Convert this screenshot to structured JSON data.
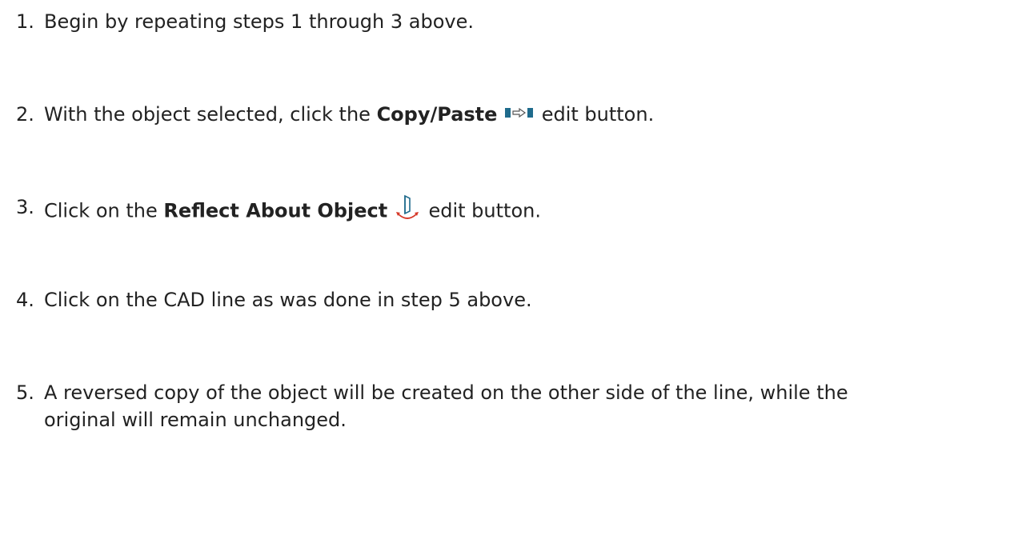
{
  "steps": [
    {
      "number": "1.",
      "text": "Begin by repeating steps 1 through 3 above."
    },
    {
      "number": "2.",
      "before": "With the object selected, click the ",
      "bold": "Copy/Paste",
      "after": " edit button.",
      "icon": "copy-paste-icon"
    },
    {
      "number": "3.",
      "before": "Click on the ",
      "bold": "Reflect About Object",
      "after": " edit button.",
      "icon": "reflect-about-object-icon"
    },
    {
      "number": "4.",
      "text": "Click on the CAD line as was done in step 5 above."
    },
    {
      "number": "5.",
      "line1": "A reversed copy of the object will be created on the other side of the line, while the",
      "line2": "original will remain unchanged."
    }
  ],
  "colors": {
    "text": "#222222",
    "icon_teal": "#1f6b8c",
    "icon_red": "#d63a2a"
  }
}
